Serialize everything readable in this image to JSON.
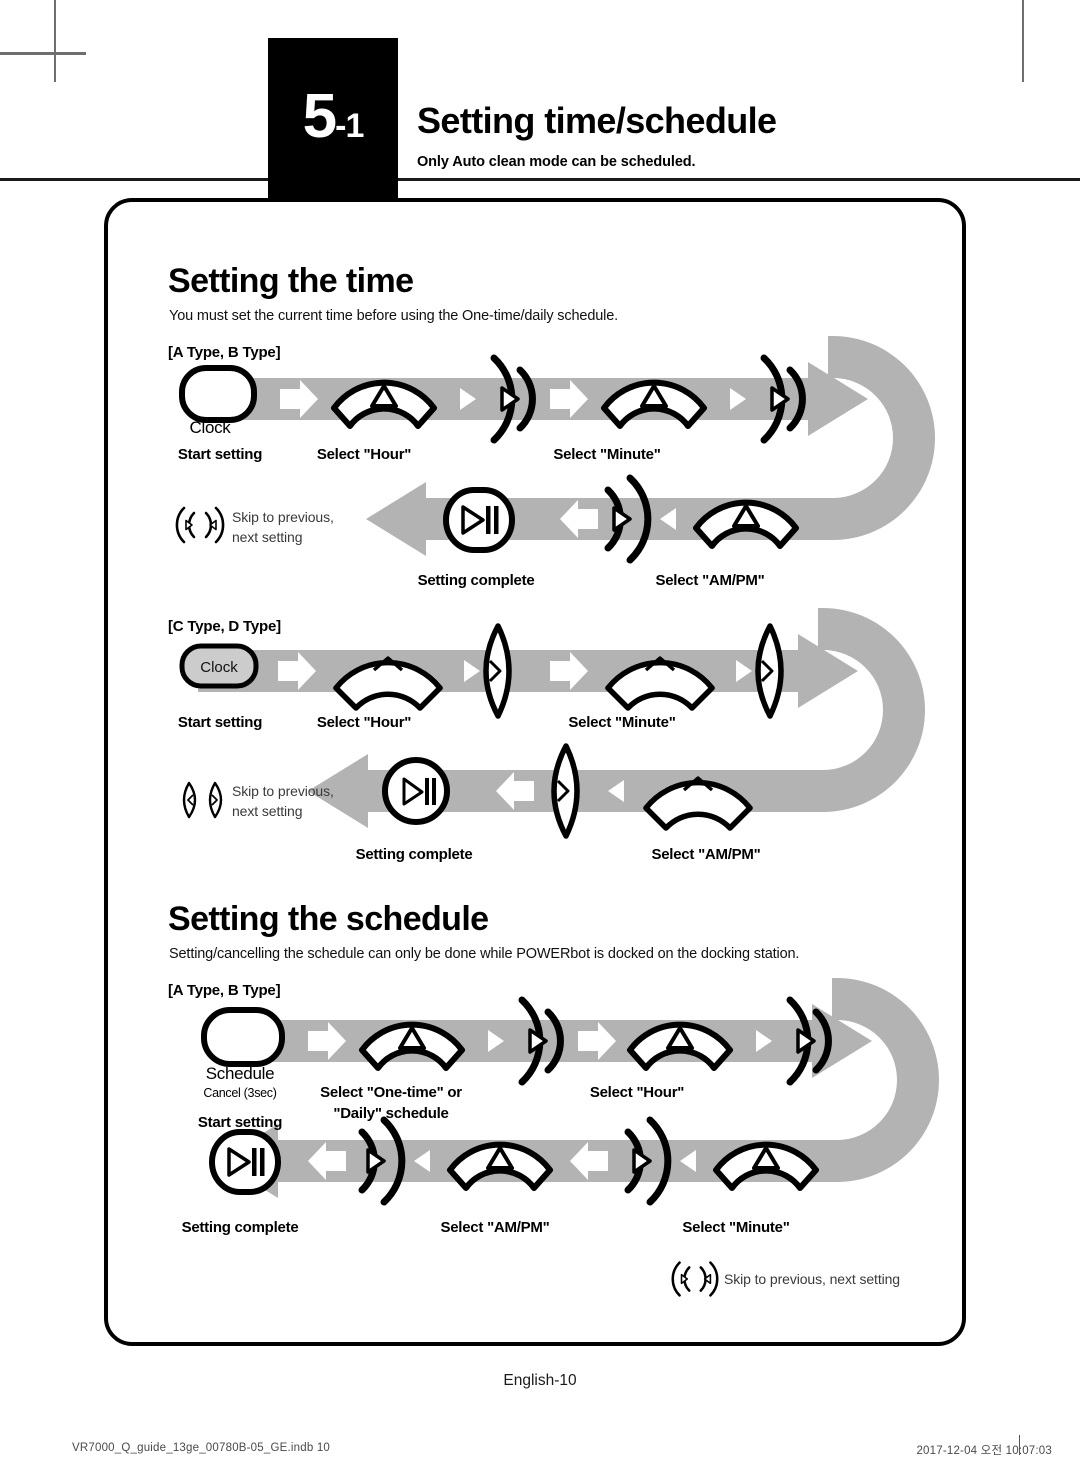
{
  "header": {
    "chapter_number": "5",
    "chapter_sub": "-1",
    "title": "Setting time/schedule",
    "subtitle": "Only Auto clean mode can be scheduled."
  },
  "sections": [
    {
      "id": "setting-the-time",
      "title": "Setting the time",
      "description": "You must set the current time before using the One-time/daily schedule.",
      "diagrams": [
        {
          "type_label": "[A Type, B Type]",
          "button_label": "Clock",
          "captions_row1": [
            "Start setting",
            "Select \"Hour\"",
            "Select \"Minute\""
          ],
          "captions_row2": [
            "Setting complete",
            "Select \"AM/PM\""
          ],
          "skip_note": "Skip to previous,\nnext setting",
          "skip_note_line1": "Skip to previous,",
          "skip_note_line2": "next setting"
        },
        {
          "type_label": "[C Type, D Type]",
          "button_label": "Clock",
          "captions_row1": [
            "Start setting",
            "Select \"Hour\"",
            "Select \"Minute\""
          ],
          "captions_row2": [
            "Setting complete",
            "Select \"AM/PM\""
          ],
          "skip_note_line1": "Skip to previous,",
          "skip_note_line2": "next setting"
        }
      ]
    },
    {
      "id": "setting-the-schedule",
      "title": "Setting the schedule",
      "description": "Setting/cancelling the schedule can only be done while POWERbot is docked on the docking station.",
      "diagrams": [
        {
          "type_label": "[A Type, B Type]",
          "button_label": "Schedule",
          "button_sub": "Cancel (3sec)",
          "captions_row1": [
            "Start setting",
            "Select \"One-time\" or",
            "\"Daily\" schedule",
            "Select \"Hour\""
          ],
          "caption_onetime_line1": "Select \"One-time\" or",
          "caption_onetime_line2": "\"Daily\" schedule",
          "captions_row2": [
            "Setting complete",
            "Select \"AM/PM\"",
            "Select \"Minute\""
          ],
          "skip_note": "Skip to previous, next setting"
        }
      ]
    }
  ],
  "footer": {
    "page_label": "English-10",
    "file_info": "VR7000_Q_guide_13ge_00780B-05_GE.indb   10",
    "timestamp": "2017-12-04   오전 10:07:03"
  },
  "colors": {
    "arrow_gray": "#b3b3b3",
    "black": "#000000",
    "note_gray": "#3a3a3a"
  },
  "icons": {
    "clock_button": "rounded-button-icon",
    "up_arc_button": "arc-up-button-icon",
    "play_pause": "play-pause-icon",
    "skip_prev": "skip-previous-icon",
    "skip_next": "skip-next-icon",
    "flow_arrow": "flow-arrow-icon"
  }
}
